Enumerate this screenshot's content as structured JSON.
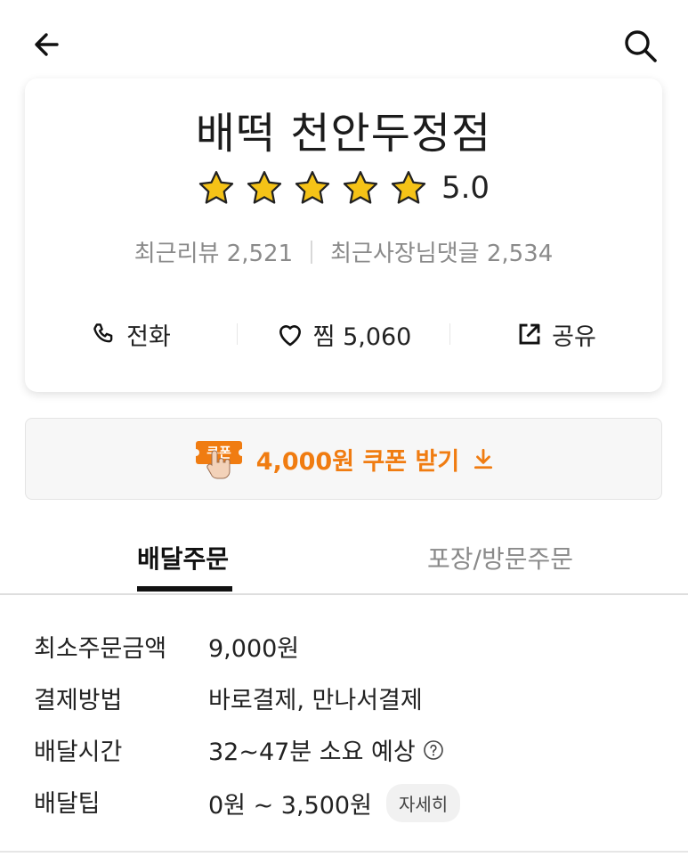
{
  "header": {
    "back_icon": "arrow-left-icon",
    "search_icon": "search-icon"
  },
  "store": {
    "name": "배떡 천안두정점",
    "rating": "5.0",
    "stars": 5,
    "recent_reviews": "최근리뷰 2,521",
    "owner_replies": "최근사장님댓글 2,534"
  },
  "actions": {
    "call_label": "전화",
    "favorite_label": "찜 5,060",
    "share_label": "공유"
  },
  "coupon": {
    "badge_text": "쿠폰",
    "label": "4,000원 쿠폰 받기",
    "accent": "#f07c11"
  },
  "tabs": {
    "delivery": "배달주문",
    "pickup": "포장/방문주문"
  },
  "info": [
    {
      "label": "최소주문금액",
      "value": "9,000원"
    },
    {
      "label": "결제방법",
      "value": "바로결제, 만나서결제"
    },
    {
      "label": "배달시간",
      "value": "32~47분 소요 예상"
    },
    {
      "label": "배달팁",
      "value": "0원 ~ 3,500원",
      "chip": "자세히"
    }
  ]
}
